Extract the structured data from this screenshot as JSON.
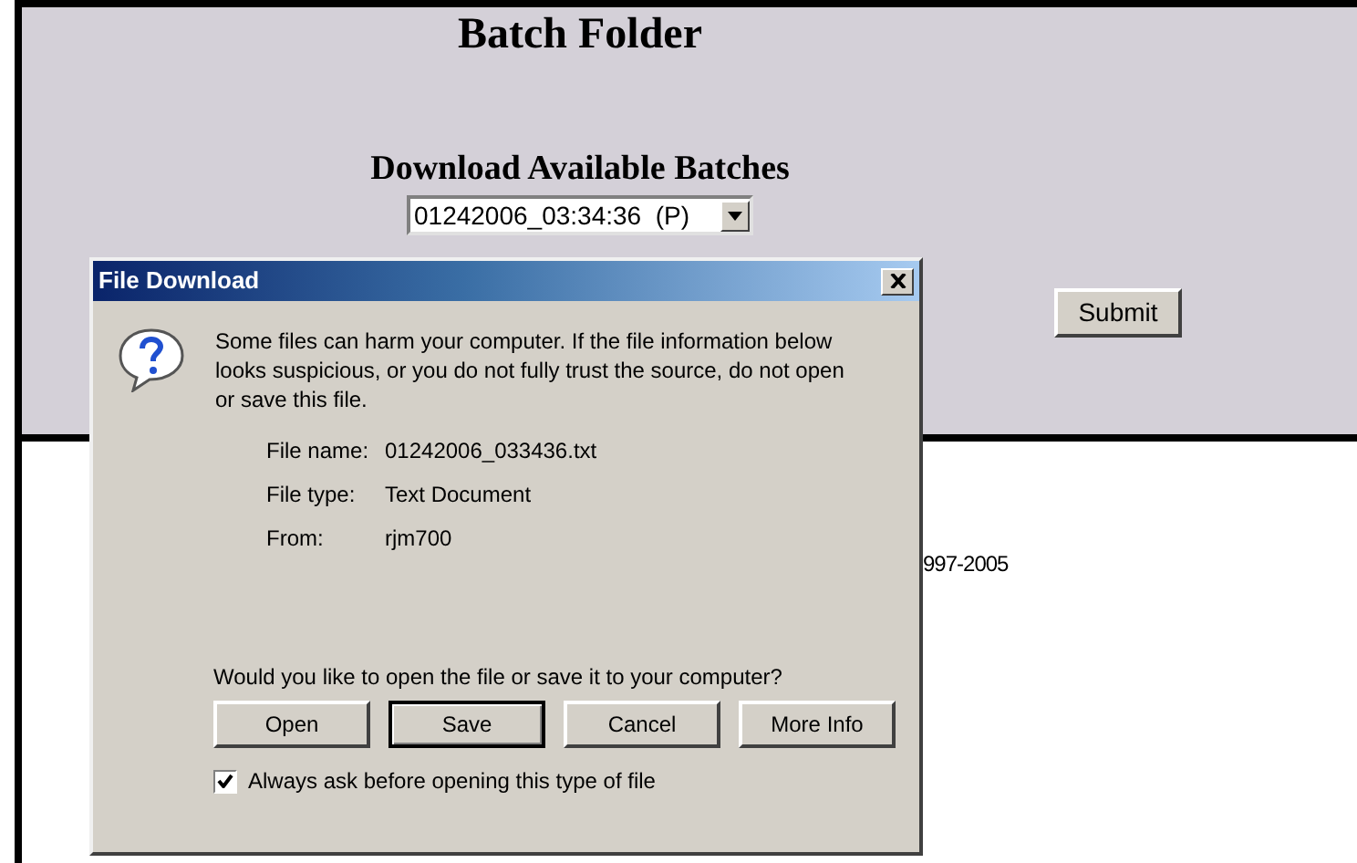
{
  "page": {
    "title": "Batch Folder",
    "subtitle": "Download Available Batches",
    "batch_select": {
      "value": "01242006_03:34:36  (P)"
    },
    "submit_button": "Submit",
    "footer_text": "997-2005"
  },
  "dialog": {
    "title": "File Download",
    "warning": "Some files can harm your computer. If the file information below looks suspicious, or you do not fully trust the source, do not open or save this file.",
    "details": [
      {
        "label": "File name:",
        "value": "01242006_033436.txt"
      },
      {
        "label": "File type:",
        "value": "Text Document"
      },
      {
        "label": "From:",
        "value": "rjm700"
      }
    ],
    "question": "Would you like to open the file or save it to your computer?",
    "buttons": [
      {
        "label": "Open",
        "selected": false
      },
      {
        "label": "Save",
        "selected": true
      },
      {
        "label": "Cancel",
        "selected": false
      },
      {
        "label": "More Info",
        "selected": false
      }
    ],
    "always_ask": {
      "label": "Always ask before opening this type of file",
      "checked": true
    }
  }
}
